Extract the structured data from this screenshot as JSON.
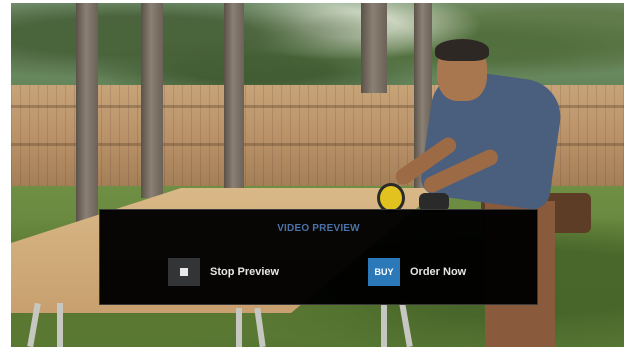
{
  "preview_dialog": {
    "title": "VIDEO PREVIEW",
    "stop_action": {
      "icon": "stop-icon",
      "label": "Stop Preview"
    },
    "buy_action": {
      "badge": "BUY",
      "label": "Order Now"
    }
  },
  "colors": {
    "title_accent": "#4b72a8",
    "buy_badge": "#2b79b8",
    "stop_badge": "#333435",
    "dialog_background": "#000000"
  }
}
